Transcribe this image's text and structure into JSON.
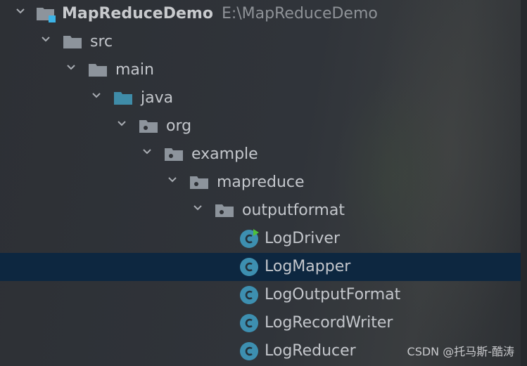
{
  "project": {
    "name": "MapReduceDemo",
    "path": "E:\\MapReduceDemo"
  },
  "tree": [
    {
      "label": "src",
      "level": 1,
      "icon": "folder-icon"
    },
    {
      "label": "main",
      "level": 2,
      "icon": "folder-icon"
    },
    {
      "label": "java",
      "level": 3,
      "icon": "source-folder-icon"
    },
    {
      "label": "org",
      "level": 4,
      "icon": "package-icon"
    },
    {
      "label": "example",
      "level": 5,
      "icon": "package-icon"
    },
    {
      "label": "mapreduce",
      "level": 6,
      "icon": "package-icon"
    },
    {
      "label": "outputformat",
      "level": 7,
      "icon": "package-icon"
    }
  ],
  "classes": [
    {
      "label": "LogDriver",
      "runnable": true
    },
    {
      "label": "LogMapper",
      "selected": true
    },
    {
      "label": "LogOutputFormat"
    },
    {
      "label": "LogRecordWriter"
    },
    {
      "label": "LogReducer"
    }
  ],
  "watermark": "CSDN @托马斯-酷涛",
  "colors": {
    "selection": "#0d2740",
    "class_icon": "#3d8fb0",
    "source_folder": "#3f8ca8",
    "folder": "#8d949c",
    "run_marker": "#4fbf3a"
  }
}
